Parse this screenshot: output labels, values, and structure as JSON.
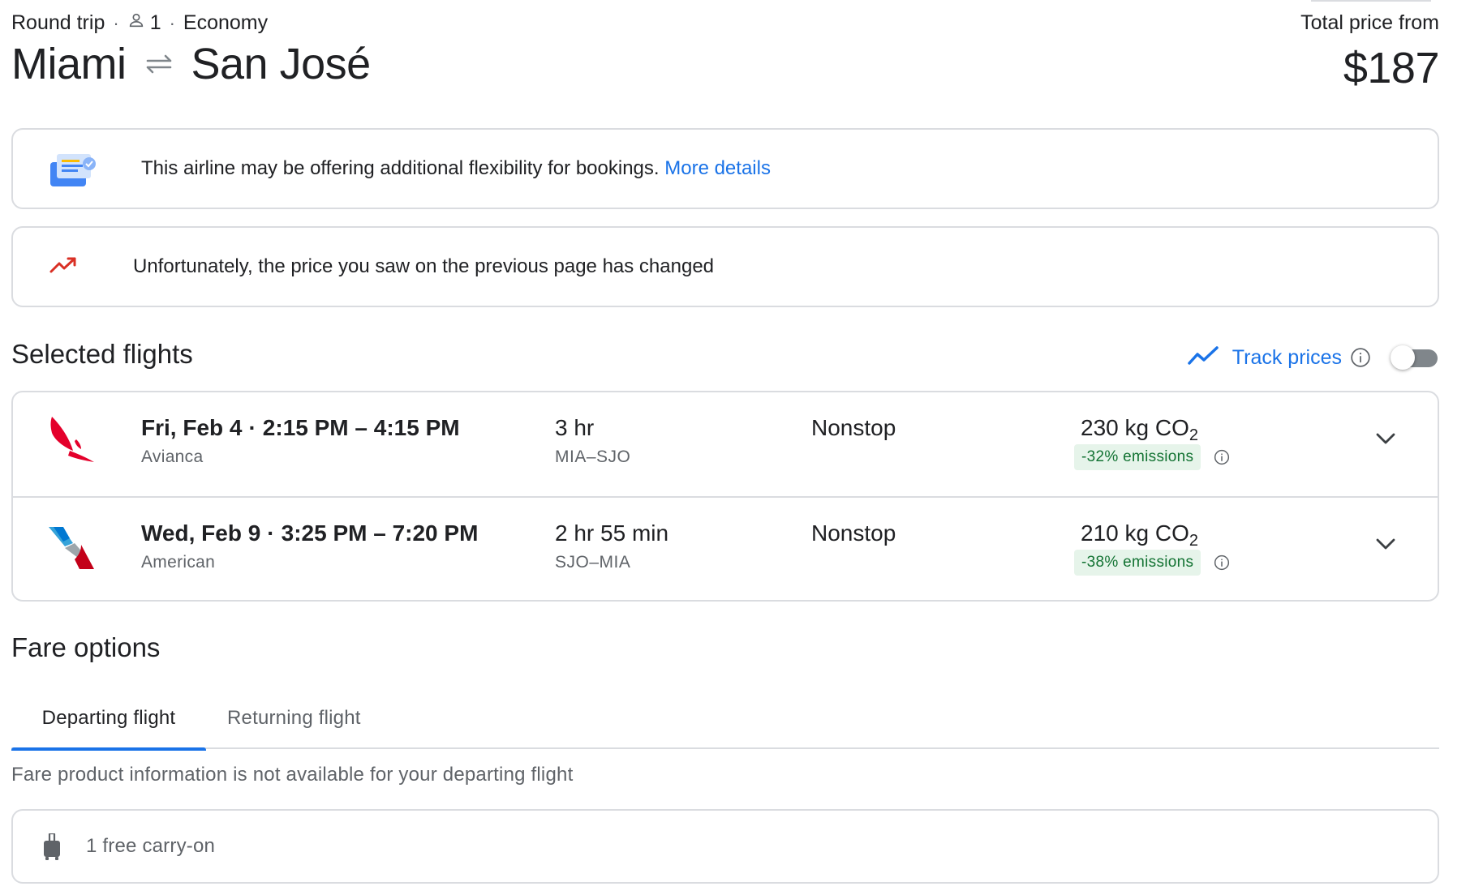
{
  "header": {
    "trip_type": "Round trip",
    "passengers": "1",
    "cabin": "Economy",
    "origin": "Miami",
    "destination": "San José",
    "price_label": "Total price from",
    "price": "$187"
  },
  "notices": {
    "flexibility_text": "This airline may be offering additional flexibility for bookings.",
    "flexibility_link": "More details",
    "price_change_text": "Unfortunately, the price you saw on the previous page has changed"
  },
  "selected_flights": {
    "title": "Selected flights",
    "track_label": "Track prices",
    "track_enabled": false,
    "flights": [
      {
        "date": "Fri, Feb 4",
        "times": "2:15 PM – 4:15 PM",
        "airline": "Avianca",
        "duration": "3 hr",
        "codes": "MIA–SJO",
        "stops": "Nonstop",
        "co2": "230 kg CO",
        "co2_sub": "2",
        "emissions": "-32% emissions",
        "logo_color": "#e4002b"
      },
      {
        "date": "Wed, Feb 9",
        "times": "3:25 PM – 7:20 PM",
        "airline": "American",
        "duration": "2 hr 55 min",
        "codes": "SJO–MIA",
        "stops": "Nonstop",
        "co2": "210 kg CO",
        "co2_sub": "2",
        "emissions": "-38% emissions",
        "logo_color": "#c30019"
      }
    ]
  },
  "fare_options": {
    "title": "Fare options",
    "tabs": [
      "Departing flight",
      "Returning flight"
    ],
    "selected_tab": "Departing flight",
    "note": "Fare product information is not available for your departing flight",
    "carry_on": "1 free carry-on"
  },
  "colors": {
    "accent": "#1a73e8",
    "border": "#dadce0",
    "badge_bg": "#e6f4ea",
    "badge_text": "#137333",
    "trend_red": "#d93025"
  }
}
